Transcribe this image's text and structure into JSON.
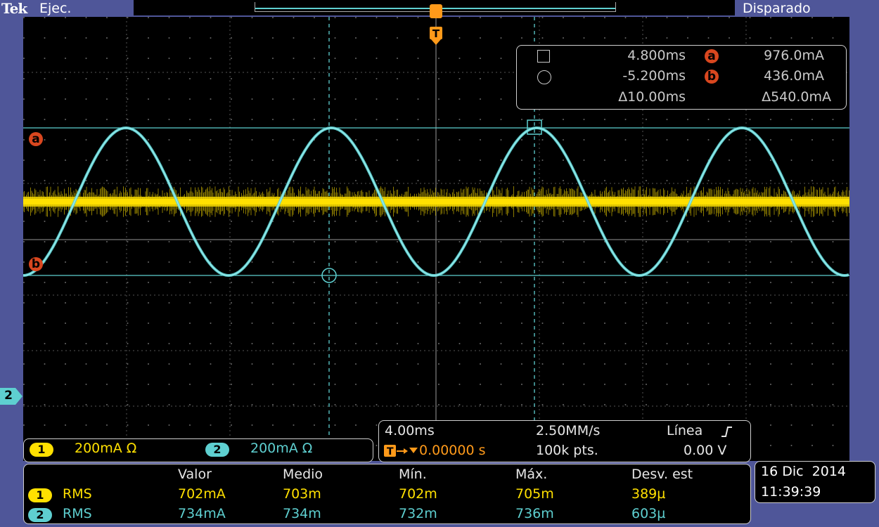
{
  "header": {
    "brand": "Tek",
    "run_state": "Ejec.",
    "trigger_status": "Disparado"
  },
  "trigger_marker": "T",
  "channel_marker_left": "2",
  "cursor_labels": {
    "a": "a",
    "b": "b"
  },
  "cursor_readout": {
    "cursor1_time": "4.800ms",
    "cursor2_time": "-5.200ms",
    "delta_time": "Δ10.00ms",
    "cursor_a_value": "976.0mA",
    "cursor_b_value": "436.0mA",
    "delta_value": "Δ540.0mA"
  },
  "channels": [
    {
      "number": "1",
      "scale": "200mA Ω",
      "color": "#ffe000"
    },
    {
      "number": "2",
      "scale": "200mA Ω",
      "color": "#5ecfd0"
    }
  ],
  "timebase": {
    "time_per_div": "4.00ms",
    "sample_rate": "2.50MM/s",
    "trigger_source": "Línea",
    "trigger_position": "0.00000 s",
    "record_length": "100k pts.",
    "trigger_level": "0.00 V"
  },
  "measurements": {
    "headers": [
      "Valor",
      "Medio",
      "Mín.",
      "Máx.",
      "Desv. est"
    ],
    "rows": [
      {
        "channel": "1",
        "type": "RMS",
        "values": [
          "702mA",
          "703m",
          "702m",
          "705m",
          "389µ"
        ]
      },
      {
        "channel": "2",
        "type": "RMS",
        "values": [
          "734mA",
          "734m",
          "732m",
          "736m",
          "603µ"
        ]
      }
    ]
  },
  "datetime": {
    "date": "16 Dic  2014",
    "time": "11:39:39"
  }
}
